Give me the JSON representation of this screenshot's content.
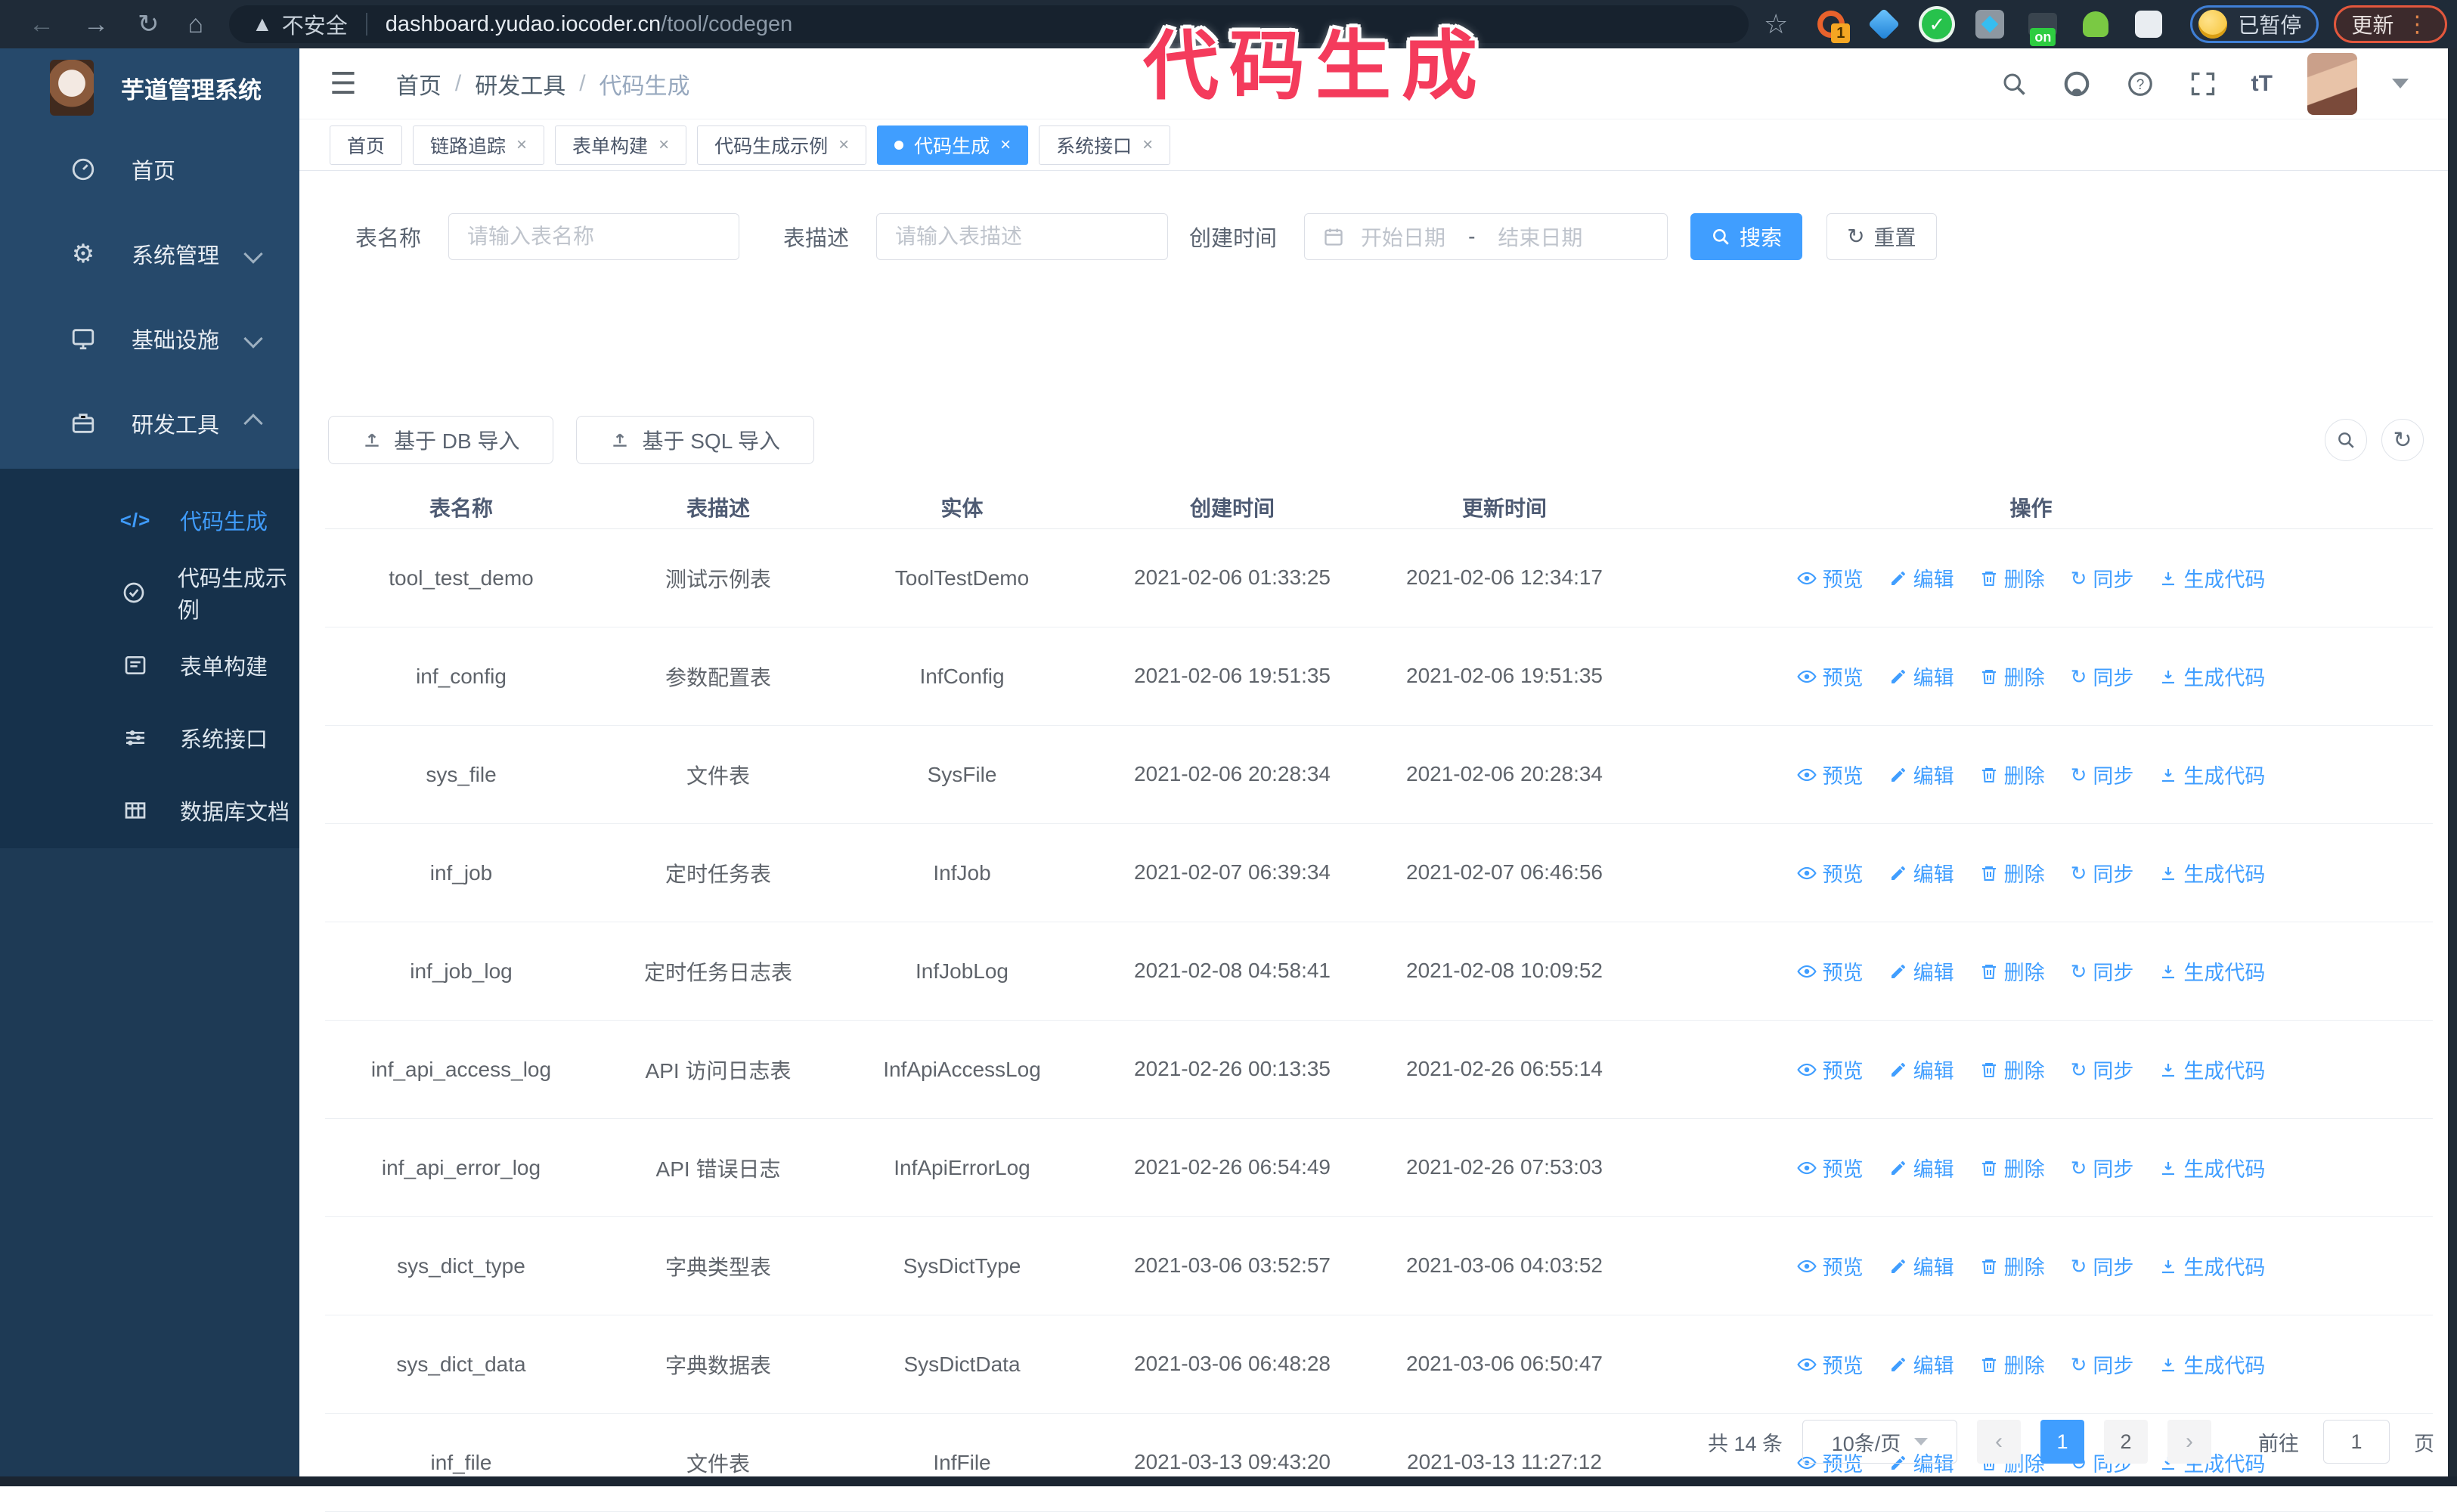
{
  "browser": {
    "security_warning": "不安全",
    "url_host": "dashboard.yudao.iocoder.cn",
    "url_path": "/tool/codegen",
    "extension_badge_1": "1",
    "extension_badge_on": "on",
    "paused_badge": "已暂停",
    "update_button": "更新"
  },
  "annotation": {
    "title": "代码生成",
    "color": "#f43b5c"
  },
  "sidebar": {
    "logo_title": "芋道管理系统",
    "items": [
      {
        "label": "首页",
        "icon": "dashboard-icon"
      },
      {
        "label": "系统管理",
        "icon": "gear-icon",
        "chevron": "down"
      },
      {
        "label": "基础设施",
        "icon": "monitor-icon",
        "chevron": "down"
      },
      {
        "label": "研发工具",
        "icon": "toolbox-icon",
        "chevron": "up",
        "expanded": true
      }
    ],
    "sub_items": [
      {
        "label": "代码生成",
        "icon": "code-icon",
        "active": true
      },
      {
        "label": "代码生成示例",
        "icon": "example-icon"
      },
      {
        "label": "表单构建",
        "icon": "form-icon"
      },
      {
        "label": "系统接口",
        "icon": "api-icon"
      },
      {
        "label": "数据库文档",
        "icon": "database-icon"
      }
    ]
  },
  "header": {
    "breadcrumb": {
      "0": "首页",
      "1": "研发工具",
      "2": "代码生成"
    }
  },
  "tabs": [
    {
      "label": "首页",
      "closable": false,
      "active": false
    },
    {
      "label": "链路追踪",
      "closable": true,
      "active": false
    },
    {
      "label": "表单构建",
      "closable": true,
      "active": false
    },
    {
      "label": "代码生成示例",
      "closable": true,
      "active": false
    },
    {
      "label": "代码生成",
      "closable": true,
      "active": true
    },
    {
      "label": "系统接口",
      "closable": true,
      "active": false
    }
  ],
  "search_form": {
    "table_name_label": "表名称",
    "table_name_placeholder": "请输入表名称",
    "table_desc_label": "表描述",
    "table_desc_placeholder": "请输入表描述",
    "create_time_label": "创建时间",
    "start_date_placeholder": "开始日期",
    "range_separator": "-",
    "end_date_placeholder": "结束日期",
    "search_button": "搜索",
    "reset_button": "重置"
  },
  "toolbar": {
    "import_db_button": "基于 DB 导入",
    "import_sql_button": "基于 SQL 导入"
  },
  "table": {
    "columns": [
      "表名称",
      "表描述",
      "实体",
      "创建时间",
      "更新时间",
      "操作"
    ],
    "actions": [
      {
        "label": "预览",
        "icon": "eye-icon"
      },
      {
        "label": "编辑",
        "icon": "edit-icon"
      },
      {
        "label": "删除",
        "icon": "delete-icon"
      },
      {
        "label": "同步",
        "icon": "sync-icon"
      },
      {
        "label": "生成代码",
        "icon": "download-icon"
      }
    ],
    "rows": [
      {
        "name": "tool_test_demo",
        "description": "测试示例表",
        "entity": "ToolTestDemo",
        "create_time": "2021-02-06 01:33:25",
        "update_time": "2021-02-06 12:34:17"
      },
      {
        "name": "inf_config",
        "description": "参数配置表",
        "entity": "InfConfig",
        "create_time": "2021-02-06 19:51:35",
        "update_time": "2021-02-06 19:51:35"
      },
      {
        "name": "sys_file",
        "description": "文件表",
        "entity": "SysFile",
        "create_time": "2021-02-06 20:28:34",
        "update_time": "2021-02-06 20:28:34"
      },
      {
        "name": "inf_job",
        "description": "定时任务表",
        "entity": "InfJob",
        "create_time": "2021-02-07 06:39:34",
        "update_time": "2021-02-07 06:46:56"
      },
      {
        "name": "inf_job_log",
        "description": "定时任务日志表",
        "entity": "InfJobLog",
        "create_time": "2021-02-08 04:58:41",
        "update_time": "2021-02-08 10:09:52"
      },
      {
        "name": "inf_api_access_log",
        "description": "API 访问日志表",
        "entity": "InfApiAccessLog",
        "create_time": "2021-02-26 00:13:35",
        "update_time": "2021-02-26 06:55:14"
      },
      {
        "name": "inf_api_error_log",
        "description": "API 错误日志",
        "entity": "InfApiErrorLog",
        "create_time": "2021-02-26 06:54:49",
        "update_time": "2021-02-26 07:53:03"
      },
      {
        "name": "sys_dict_type",
        "description": "字典类型表",
        "entity": "SysDictType",
        "create_time": "2021-03-06 03:52:57",
        "update_time": "2021-03-06 04:03:52"
      },
      {
        "name": "sys_dict_data",
        "description": "字典数据表",
        "entity": "SysDictData",
        "create_time": "2021-03-06 06:48:28",
        "update_time": "2021-03-06 06:50:47"
      },
      {
        "name": "inf_file",
        "description": "文件表",
        "entity": "InfFile",
        "create_time": "2021-03-13 09:43:20",
        "update_time": "2021-03-13 11:27:12"
      }
    ]
  },
  "pagination": {
    "total_text": "共 14 条",
    "page_size": "10条/页",
    "pages": {
      "0": "1",
      "1": "2"
    },
    "active_page": "1",
    "goto_label": "前往",
    "goto_value": "1",
    "goto_suffix": "页"
  },
  "colors": {
    "primary": "#409eff",
    "sidebar": "#26496b",
    "sidebar_submenu": "#16314b",
    "chrome": "#1f2b38",
    "annotation": "#f43b5c"
  }
}
